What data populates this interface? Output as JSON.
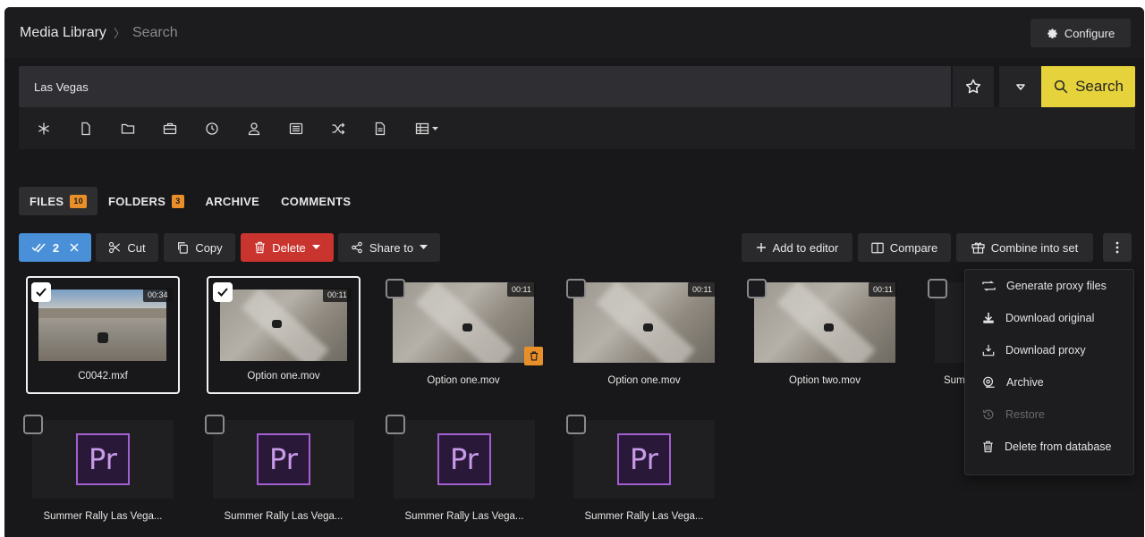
{
  "header": {
    "breadcrumb": {
      "root": "Media Library",
      "separator": "〉",
      "current": "Search"
    },
    "configure_label": "Configure"
  },
  "search": {
    "value": "Las Vegas",
    "button_label": "Search"
  },
  "filters": [
    "asterisk-icon",
    "file-icon",
    "folder-icon",
    "briefcase-icon",
    "clock-icon",
    "user-icon",
    "list-icon",
    "shuffle-icon",
    "document-icon",
    "table-icon"
  ],
  "tabs": [
    {
      "label": "FILES",
      "badge": "10",
      "active": true
    },
    {
      "label": "FOLDERS",
      "badge": "3",
      "active": false
    },
    {
      "label": "ARCHIVE",
      "badge": "",
      "active": false
    },
    {
      "label": "COMMENTS",
      "badge": "",
      "active": false
    }
  ],
  "toolbar": {
    "selected_count": "2",
    "cut_label": "Cut",
    "copy_label": "Copy",
    "delete_label": "Delete",
    "share_label": "Share to",
    "add_editor_label": "Add to editor",
    "compare_label": "Compare",
    "combine_label": "Combine into set"
  },
  "files": [
    {
      "name": "C0042.mxf",
      "duration": "00:34",
      "selected": true,
      "thumb": "desert"
    },
    {
      "name": "Option one.mov",
      "duration": "00:11",
      "selected": true,
      "thumb": "road"
    },
    {
      "name": "Option one.mov",
      "duration": "00:11",
      "selected": false,
      "thumb": "road"
    },
    {
      "name": "Option one.mov",
      "duration": "00:11",
      "selected": false,
      "thumb": "road"
    },
    {
      "name": "Option two.mov",
      "duration": "00:11",
      "selected": false,
      "thumb": "road"
    },
    {
      "name": "Sum",
      "duration": "",
      "selected": false,
      "thumb": "dark"
    },
    {
      "name": "Summer Rally Las Vega...",
      "duration": "",
      "selected": false,
      "thumb": "premiere"
    },
    {
      "name": "Summer Rally Las Vega...",
      "duration": "",
      "selected": false,
      "thumb": "premiere"
    },
    {
      "name": "Summer Rally Las Vega...",
      "duration": "",
      "selected": false,
      "thumb": "premiere"
    },
    {
      "name": "Summer Rally Las Vega...",
      "duration": "",
      "selected": false,
      "thumb": "premiere"
    }
  ],
  "premiere_logo_text": "Pr",
  "context_menu": [
    {
      "label": "Generate proxy files",
      "icon": "proxy-icon",
      "disabled": false
    },
    {
      "label": "Download original",
      "icon": "download-icon",
      "disabled": false
    },
    {
      "label": "Download proxy",
      "icon": "download-proxy-icon",
      "disabled": false
    },
    {
      "label": "Archive",
      "icon": "archive-icon",
      "disabled": false
    },
    {
      "label": "Restore",
      "icon": "restore-icon",
      "disabled": true
    },
    {
      "label": "Delete from database",
      "icon": "trash-icon",
      "disabled": false
    }
  ],
  "colors": {
    "accent_yellow": "#e6d33c",
    "selection_blue": "#4a90d9",
    "delete_red": "#c9342f",
    "badge_orange": "#e88f2a",
    "premiere_purple": "#a35fd1"
  }
}
